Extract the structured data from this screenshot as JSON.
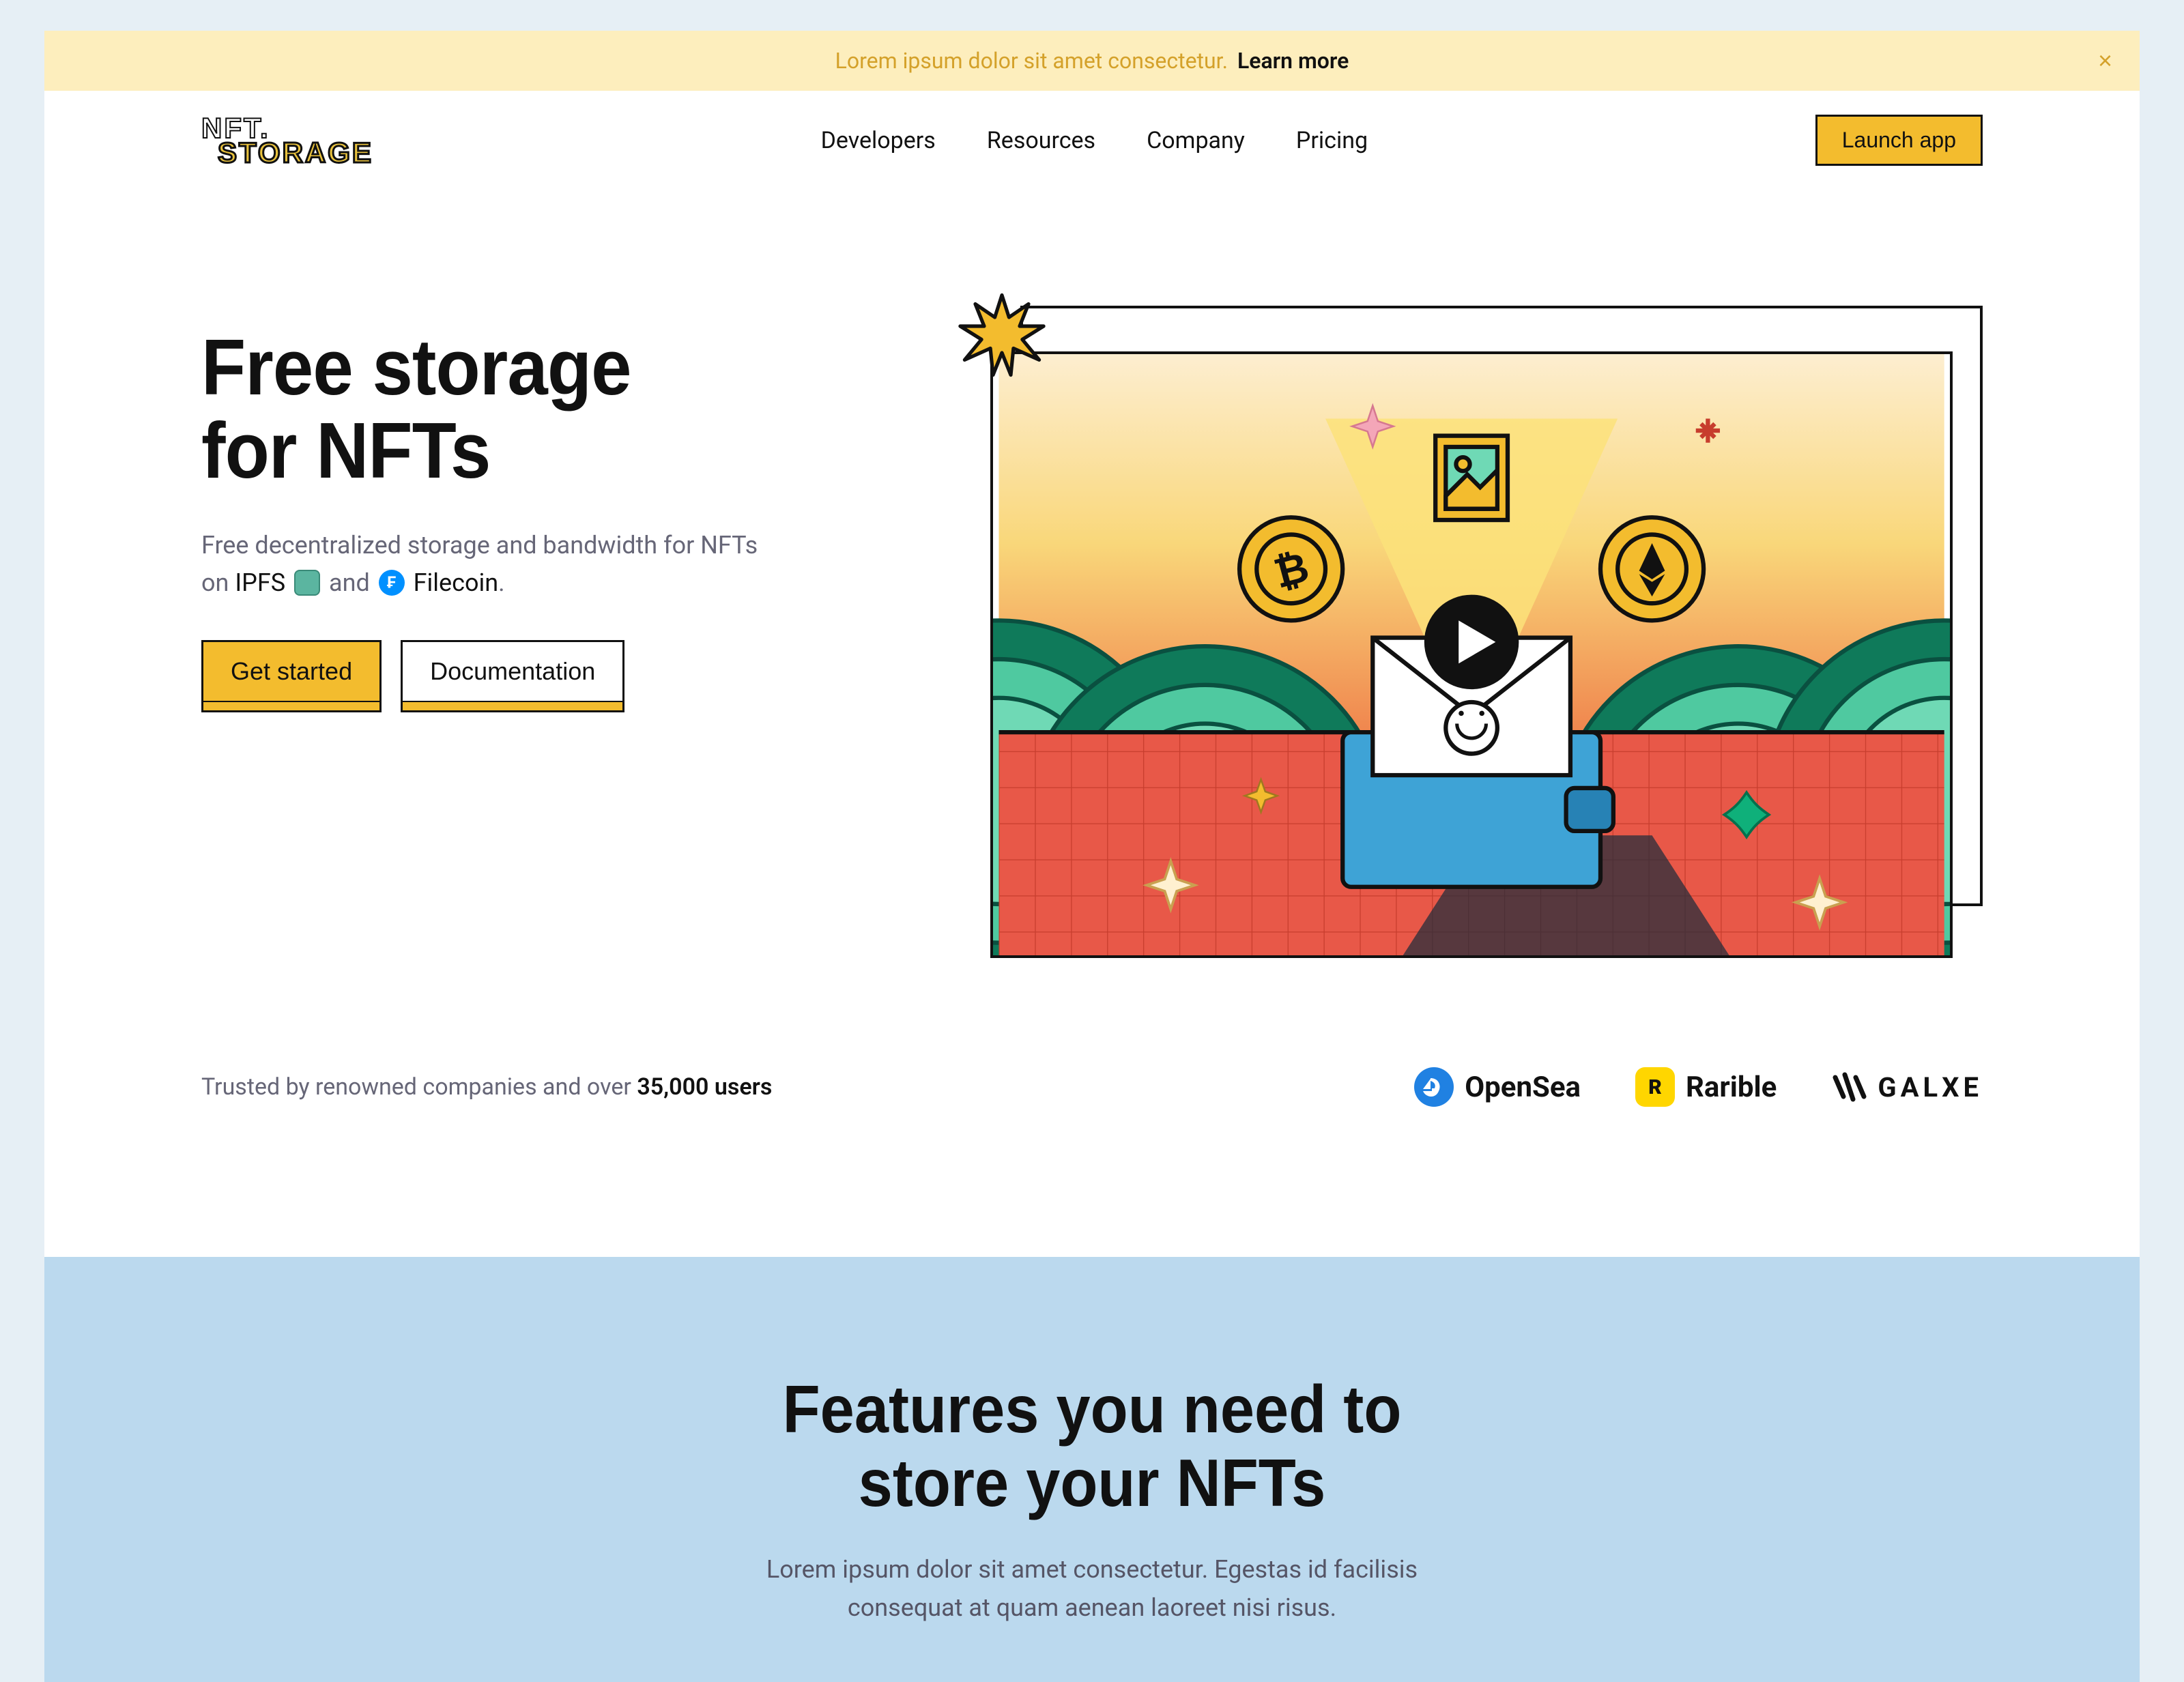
{
  "banner": {
    "text": "Lorem ipsum dolor sit amet consectetur.",
    "link": "Learn more",
    "close": "×"
  },
  "header": {
    "logo_line1": "NFT.",
    "logo_line2": "STORAGE",
    "nav": [
      "Developers",
      "Resources",
      "Company",
      "Pricing"
    ],
    "cta": "Launch app"
  },
  "hero": {
    "title_line1": "Free storage",
    "title_line2": "for NFTs",
    "desc_pre": "Free decentralized storage and bandwidth for NFTs on ",
    "ipfs": "IPFS",
    "desc_mid": " and ",
    "filecoin": "Filecoin",
    "desc_post": ".",
    "cta_primary": "Get started",
    "cta_secondary": "Documentation"
  },
  "trusted": {
    "text_pre": "Trusted by renowned companies and over ",
    "count": "35,000 users"
  },
  "partners": {
    "opensea": "OpenSea",
    "rarible": "Rarible",
    "rarible_icon": "R",
    "galxe": "GALXE"
  },
  "features": {
    "title_line1": "Features you need to",
    "title_line2": "store your NFTs",
    "desc": "Lorem ipsum dolor sit amet consectetur. Egestas id facilisis consequat at quam aenean laoreet nisi risus."
  }
}
